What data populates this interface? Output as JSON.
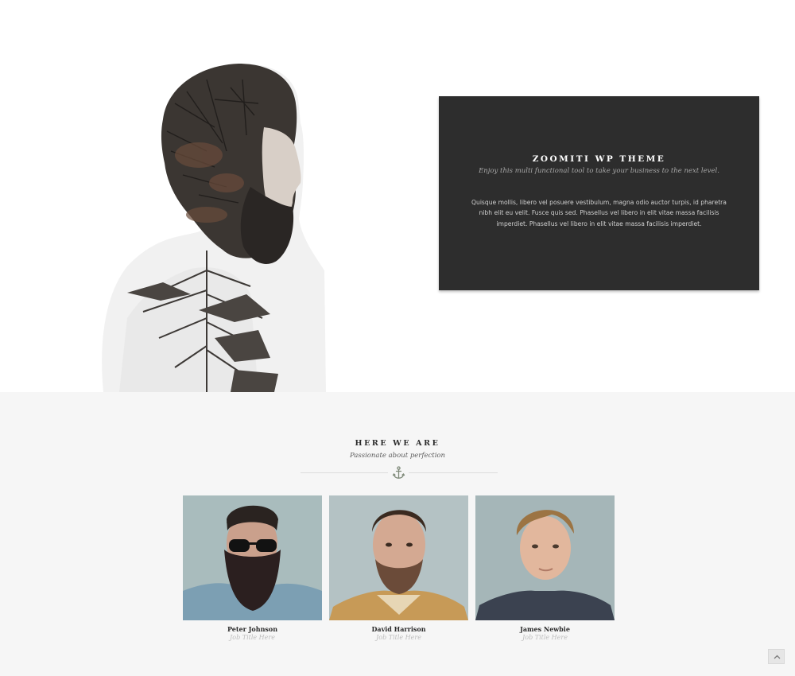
{
  "promo": {
    "title": "ZOOMITI WP THEME",
    "subtitle": "Enjoy this multi functional tool to take your business to the next level.",
    "body": "Quisque mollis, libero vel posuere vestibulum, magna odio auctor turpis, id pharetra nibh elit eu velit. Fusce quis sed. Phasellus vel libero in elit vitae massa facilisis imperdiet. Phasellus vel libero in elit vitae massa facilisis imperdiet."
  },
  "team": {
    "title": "HERE WE ARE",
    "subtitle": "Passionate about perfection",
    "divider_icon": "anchor-icon",
    "members": [
      {
        "name": "Peter Johnson",
        "job": "Job Title Here"
      },
      {
        "name": "David Harrison",
        "job": "Job Title Here"
      },
      {
        "name": "James Newbie",
        "job": "Job Title Here"
      }
    ]
  },
  "icons": {
    "hero": "double-exposure-portrait",
    "back_to_top": "chevron-up-icon"
  },
  "colors": {
    "dark_box": "#2d2d2d",
    "team_bg": "#f6f6f6",
    "photo_bg": "#a9bcbd",
    "anchor": "#7f8a79"
  }
}
